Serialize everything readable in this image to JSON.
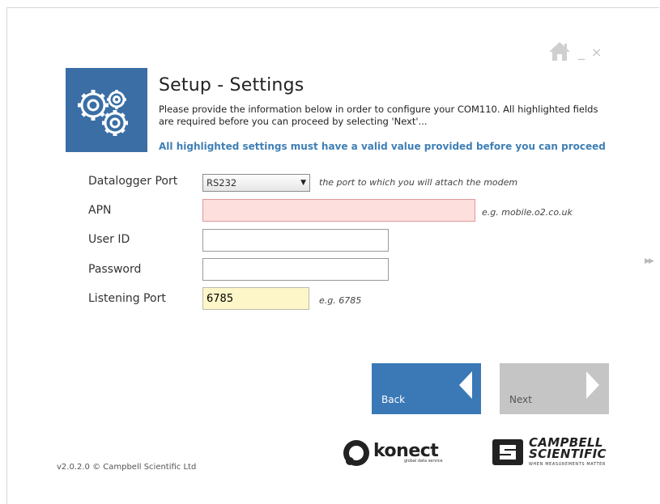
{
  "header": {
    "title": "Setup - Settings",
    "description": "Please provide the information below in order to configure your COM110.  All highlighted fields are required before you can proceed by selecting 'Next'...",
    "notice": "All highlighted settings must have a valid value provided before you can proceed"
  },
  "window_controls": {
    "minimize": "_",
    "close": "×"
  },
  "form": {
    "datalogger_port": {
      "label": "Datalogger Port",
      "selected": "RS232",
      "hint": "the port to which you will attach the modem"
    },
    "apn": {
      "label": "APN",
      "value": "",
      "hint": "e.g. mobile.o2.co.uk",
      "color": "#fde0de"
    },
    "user_id": {
      "label": "User ID",
      "value": ""
    },
    "password": {
      "label": "Password",
      "value": ""
    },
    "listening_port": {
      "label": "Listening Port",
      "value": "6785",
      "hint": "e.g. 6785",
      "color": "#fdf6c9"
    }
  },
  "nav": {
    "back_label": "Back",
    "next_label": "Next",
    "back_color": "#3a79b6",
    "next_color": "#c5c5c5"
  },
  "footer": {
    "version": "v2.0.2.0 © Campbell Scientific Ltd"
  },
  "logos": {
    "konect": {
      "name": "konect",
      "tagline": "global data service"
    },
    "campbell": {
      "line1": "CAMPBELL",
      "line2": "SCIENTIFIC",
      "tagline": "WHEN MEASUREMENTS MATTER"
    }
  },
  "icons": [
    "home-icon",
    "minimize-icon",
    "close-icon",
    "gears-icon",
    "dropdown-arrow-icon",
    "back-arrow-icon",
    "next-arrow-icon",
    "scroll-right-icon"
  ]
}
